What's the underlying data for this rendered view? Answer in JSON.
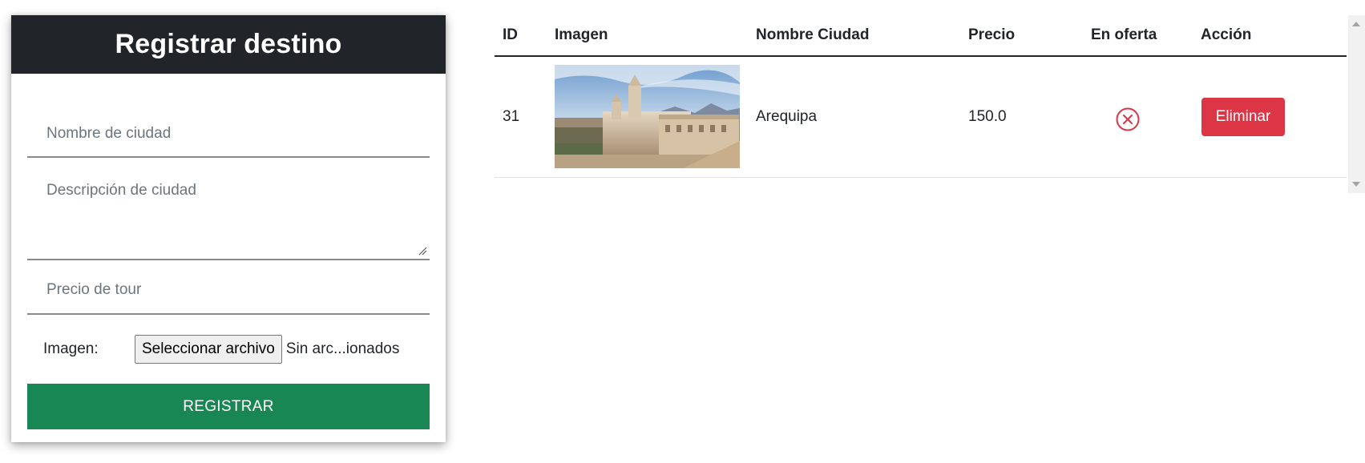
{
  "form": {
    "title": "Registrar destino",
    "city_name_placeholder": "Nombre de ciudad",
    "city_description_placeholder": "Descripción de ciudad",
    "tour_price_placeholder": "Precio de tour",
    "image_label": "Imagen:",
    "file_button_label": "Seleccionar archivo",
    "file_status": "Sin arc...ionados",
    "submit_label": "REGISTRAR"
  },
  "table": {
    "headers": [
      "ID",
      "Imagen",
      "Nombre Ciudad",
      "Precio",
      "En oferta",
      "Acción"
    ],
    "rows": [
      {
        "id": "31",
        "image": "arequipa-cathedral-photo",
        "city": "Arequipa",
        "price": "150.0",
        "on_offer_icon": "x-circle-icon",
        "action_label": "Eliminar"
      }
    ]
  },
  "colors": {
    "header_dark": "#212529",
    "submit_green": "#198754",
    "danger_red": "#dc3545"
  }
}
